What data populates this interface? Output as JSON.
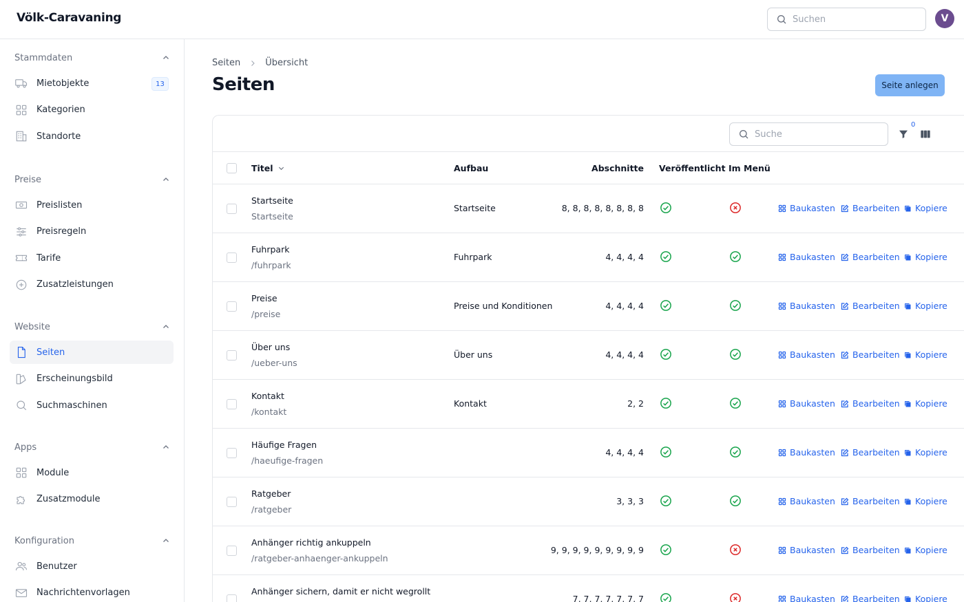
{
  "header": {
    "brand": "Völk-Caravaning",
    "search_placeholder": "Suchen",
    "avatar_initial": "V"
  },
  "colors": {
    "accent": "#2563eb",
    "primary_button": "#7fb4f5",
    "success": "#16a34a",
    "danger": "#dc2626",
    "avatar": "#6b4c8f"
  },
  "sidebar": {
    "groups": [
      {
        "label": "Stammdaten",
        "items": [
          {
            "label": "Mietobjekte",
            "icon": "truck-icon",
            "badge": "13"
          },
          {
            "label": "Kategorien",
            "icon": "grid-icon"
          },
          {
            "label": "Standorte",
            "icon": "building-icon"
          }
        ]
      },
      {
        "label": "Preise",
        "items": [
          {
            "label": "Preislisten",
            "icon": "banknote-icon"
          },
          {
            "label": "Preisregeln",
            "icon": "sliders-icon"
          },
          {
            "label": "Tarife",
            "icon": "ticket-icon"
          },
          {
            "label": "Zusatzleistungen",
            "icon": "plus-circle-icon"
          }
        ]
      },
      {
        "label": "Website",
        "items": [
          {
            "label": "Seiten",
            "icon": "document-icon",
            "active": true
          },
          {
            "label": "Erscheinungsbild",
            "icon": "palette-icon"
          },
          {
            "label": "Suchmaschinen",
            "icon": "magnifier-icon"
          }
        ]
      },
      {
        "label": "Apps",
        "items": [
          {
            "label": "Module",
            "icon": "grid-icon"
          },
          {
            "label": "Zusatzmodule",
            "icon": "puzzle-icon"
          }
        ]
      },
      {
        "label": "Konfiguration",
        "items": [
          {
            "label": "Benutzer",
            "icon": "users-icon"
          },
          {
            "label": "Nachrichtenvorlagen",
            "icon": "envelope-icon"
          }
        ]
      }
    ]
  },
  "breadcrumb": {
    "parent": "Seiten",
    "current": "Übersicht"
  },
  "page": {
    "title": "Seiten",
    "create_button": "Seite anlegen"
  },
  "table": {
    "search_placeholder": "Suche",
    "filter_count": "0",
    "columns": {
      "title": "Titel",
      "layout": "Aufbau",
      "sections": "Abschnitte",
      "published": "Veröffentlicht",
      "in_menu": "Im Menü"
    },
    "actions": {
      "builder": "Baukasten",
      "edit": "Bearbeiten",
      "copy": "Kopiere"
    },
    "rows": [
      {
        "title": "Startseite",
        "slug": "Startseite",
        "layout": "Startseite",
        "sections": "8, 8, 8, 8, 8, 8, 8, 8",
        "published": true,
        "in_menu": false
      },
      {
        "title": "Fuhrpark",
        "slug": "/fuhrpark",
        "layout": "Fuhrpark",
        "sections": "4, 4, 4, 4",
        "published": true,
        "in_menu": true
      },
      {
        "title": "Preise",
        "slug": "/preise",
        "layout": "Preise und Konditionen",
        "sections": "4, 4, 4, 4",
        "published": true,
        "in_menu": true
      },
      {
        "title": "Über uns",
        "slug": "/ueber-uns",
        "layout": "Über uns",
        "sections": "4, 4, 4, 4",
        "published": true,
        "in_menu": true
      },
      {
        "title": "Kontakt",
        "slug": "/kontakt",
        "layout": "Kontakt",
        "sections": "2, 2",
        "published": true,
        "in_menu": true
      },
      {
        "title": "Häufige Fragen",
        "slug": "/haeufige-fragen",
        "layout": "",
        "sections": "4, 4, 4, 4",
        "published": true,
        "in_menu": true
      },
      {
        "title": "Ratgeber",
        "slug": "/ratgeber",
        "layout": "",
        "sections": "3, 3, 3",
        "published": true,
        "in_menu": true
      },
      {
        "title": "Anhänger richtig ankuppeln",
        "slug": "/ratgeber-anhaenger-ankuppeln",
        "layout": "",
        "sections": "9, 9, 9, 9, 9, 9, 9, 9, 9",
        "published": true,
        "in_menu": false
      },
      {
        "title": "Anhänger sichern, damit er nicht wegrollt",
        "slug": "",
        "layout": "",
        "sections": "7, 7, 7, 7, 7, 7, 7",
        "published": true,
        "in_menu": false
      }
    ]
  }
}
